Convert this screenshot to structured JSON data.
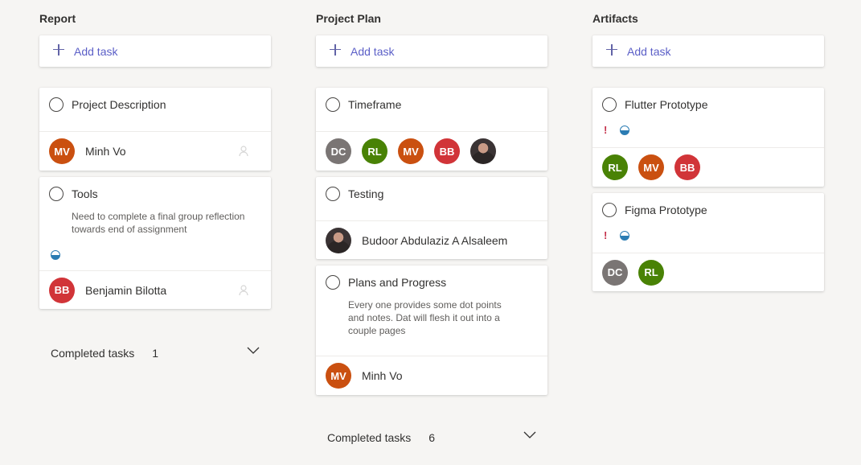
{
  "add_task_label": "Add task",
  "colors": {
    "MV": "#ca5010",
    "BB": "#d13438",
    "DC": "#7a7574",
    "RL": "#498205",
    "accent": "#6264a7",
    "progress": "#2b7cb3",
    "priority": "#c4314b"
  },
  "buckets": [
    {
      "title": "Report",
      "cards": [
        {
          "title": "Project Description",
          "assignee_initials": "MV",
          "assignee_name": "Minh Vo"
        },
        {
          "title": "Tools",
          "note": "Need to complete a final group reflection towards end of assignment",
          "progress": "in-progress",
          "assignee_initials": "BB",
          "assignee_name": "Benjamin Bilotta"
        }
      ],
      "completed_label": "Completed tasks",
      "completed_count": "1"
    },
    {
      "title": "Project Plan",
      "cards": [
        {
          "title": "Timeframe",
          "avatars": [
            "DC",
            "RL",
            "MV",
            "BB",
            "photo"
          ]
        },
        {
          "title": "Testing",
          "assignee_name": "Budoor Abdulaziz A Alsaleem",
          "assignee_photo": true
        },
        {
          "title": "Plans and Progress",
          "note": "Every one provides some dot points and notes. Dat will flesh it out into a couple pages",
          "assignee_initials": "MV",
          "assignee_name": "Minh Vo"
        }
      ],
      "completed_label": "Completed tasks",
      "completed_count": "6"
    },
    {
      "title": "Artifacts",
      "cards": [
        {
          "title": "Flutter Prototype",
          "priority": "!",
          "progress": "in-progress",
          "avatars": [
            "RL",
            "MV",
            "BB"
          ]
        },
        {
          "title": "Figma Prototype",
          "priority": "!",
          "progress": "in-progress",
          "avatars": [
            "DC",
            "RL"
          ]
        }
      ]
    }
  ]
}
